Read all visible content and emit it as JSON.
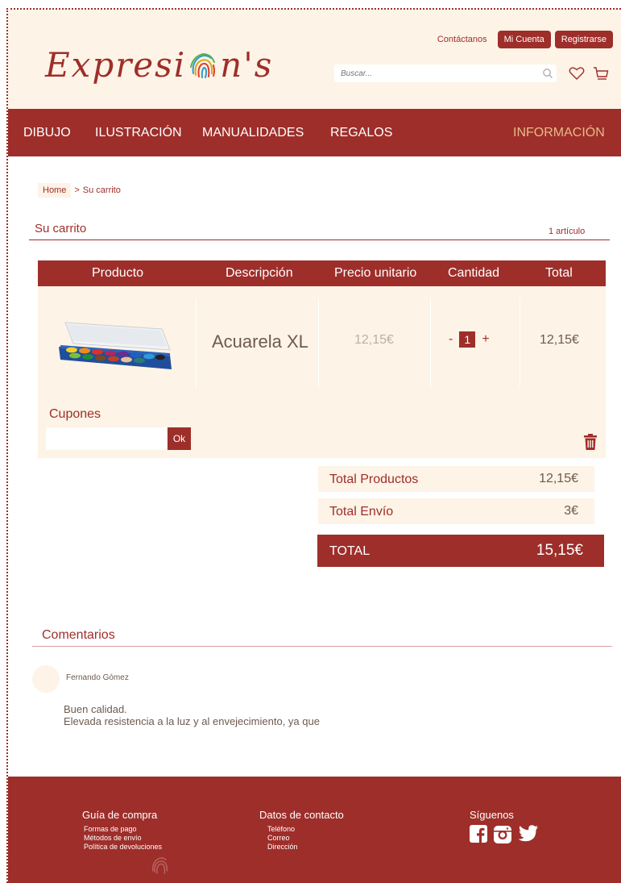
{
  "header": {
    "logo_text_left": "Expresi",
    "logo_text_right": "n's",
    "contact_label": "Contáctanos",
    "account_label": "Mi Cuenta",
    "register_label": "Registrarse",
    "search_placeholder": "Buscar..."
  },
  "nav": {
    "items": [
      {
        "label": "DIBUJO"
      },
      {
        "label": "ILUSTRACIÓN"
      },
      {
        "label": "MANUALIDADES"
      },
      {
        "label": "REGALOS"
      },
      {
        "label": "INFORMACIÓN"
      }
    ]
  },
  "breadcrumb": {
    "home": "Home",
    "separator": ">",
    "current": "Su carrito"
  },
  "cart": {
    "title": "Su carrito",
    "item_count": "1 artículo",
    "columns": [
      "Producto",
      "Descripción",
      "Precio unitario",
      "Cantidad",
      "Total"
    ],
    "row": {
      "description": "Acuarela XL",
      "unit_price": "12,15€",
      "qty_minus": "-",
      "quantity": "1",
      "qty_plus": "+",
      "total": "12,15€"
    },
    "coupons_label": "Cupones",
    "coupon_ok": "Ok"
  },
  "totals": {
    "products_label": "Total Productos",
    "products_value": "12,15€",
    "shipping_label": "Total Envío",
    "shipping_value": "3€",
    "total_label": "TOTAL",
    "total_value": "15,15€"
  },
  "comments": {
    "title": "Comentarios",
    "author": "Fernando Gómez",
    "line1": "Buen calidad.",
    "line2": "Elevada resistencia a la luz y al envejecimiento, ya que"
  },
  "footer": {
    "guide_title": "Guía de compra",
    "guide_links": [
      "Formas de pago",
      "Métodos de envío",
      "Política de devoluciones"
    ],
    "contact_title": "Datos de contacto",
    "contact_links": [
      "Teléfono",
      "Correo",
      "Dirección"
    ],
    "social_title": "Síguenos"
  },
  "colors": {
    "brand": "#9e2e2a",
    "cream": "#fdf3e6",
    "nav_highlight": "#e8b98a"
  },
  "icons": [
    "search-icon",
    "heart-icon",
    "cart-icon",
    "trash-icon",
    "facebook-icon",
    "instagram-icon",
    "twitter-icon",
    "fingerprint-icon"
  ]
}
